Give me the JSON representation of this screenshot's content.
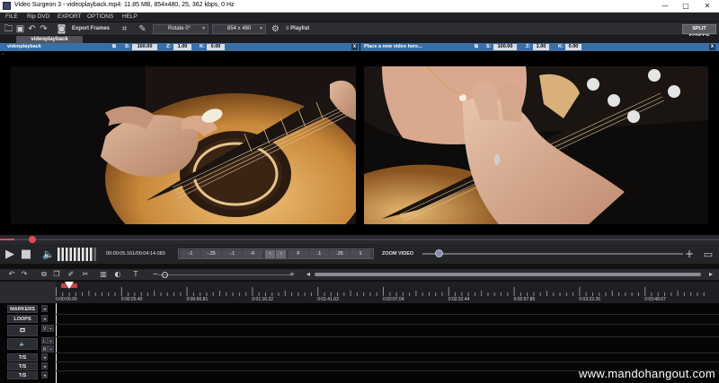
{
  "window": {
    "title": "Video Surgeon 3 - videoplayback.mp4: 11.85 MB, 854x480, 25, 362 kbps, 0 Hz",
    "minimize": "—",
    "maximize": "□",
    "close": "✕"
  },
  "menu": [
    "FILE",
    "Rip DVD",
    "EXPORT",
    "OPTIONS",
    "HELP"
  ],
  "toolbar": {
    "export_frames": "Export Frames",
    "rotate": "Rotate 0°",
    "resolution": "854 x 480",
    "playlist": "Playlist",
    "split_screen": "SPLIT SCREEN"
  },
  "tab": {
    "label": "videoplayback"
  },
  "left_panel": {
    "label": "videoplayback",
    "s_label": "S:",
    "s_value": "100.00",
    "z_label": "Z:",
    "z_value": "1.00",
    "k_label": "K:",
    "k_value": "0.00",
    "close": "x"
  },
  "right_panel": {
    "label": "Place a new video here...",
    "s_label": "S:",
    "s_value": "100.00",
    "z_label": "Z:",
    "z_value": "1.00",
    "k_label": "K:",
    "k_value": "0.00",
    "close": "x"
  },
  "playback": {
    "timecode": "00:00:05.161/00:04:14.080",
    "progress_fraction": 0.02,
    "zoom_label": "ZOOM VIDEO",
    "zoom_fraction": 0.02,
    "speed_buttons": [
      "-1",
      "-.25",
      "-.1",
      "-F",
      "‹",
      "›",
      "F",
      ".1",
      ".25",
      "1"
    ],
    "volume_level": 0.85
  },
  "timeline": {
    "ruler_labels": [
      "0:00:00.00",
      "0:00:25.40",
      "0:00:50.81",
      "0:01:16.22",
      "0:01:41.63",
      "0:02:07.04",
      "0:02:32.44",
      "0:02:57.85",
      "0:03:23.26",
      "0:03:48.67"
    ],
    "track_labels": {
      "markers": "MARKERS",
      "loops": "LOOPS",
      "v": "V",
      "l": "L",
      "r": "R",
      "t1": "T/S",
      "t2": "T/S",
      "t3": "T/S"
    }
  },
  "watermark": "www.mandohangout.com",
  "colors": {
    "panel_header": "#3a6fa6",
    "playhead": "#e24a54",
    "background": "#000000"
  }
}
